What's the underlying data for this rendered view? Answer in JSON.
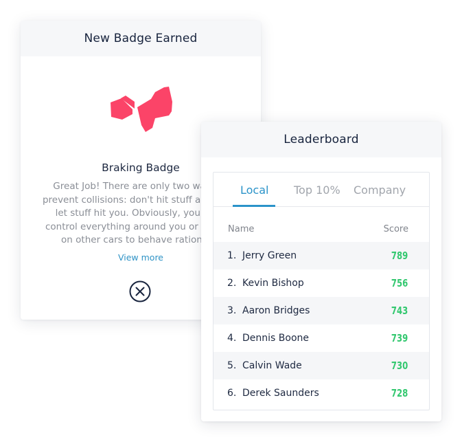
{
  "badge_card": {
    "title": "New Badge Earned",
    "badge_name": "Braking Badge",
    "description": "Great Job! There are only two ways to prevent collisions: don't hit stuff and don't let stuff hit you. Obviously, you can't control everything around you or depend on other cars to behave rationally.",
    "view_more_label": "View more",
    "badge_color": "#fb4468",
    "close_icon": "close-circle-icon"
  },
  "leaderboard": {
    "title": "Leaderboard",
    "tabs": [
      {
        "label": "Local",
        "active": true
      },
      {
        "label": "Top 10%",
        "active": false
      },
      {
        "label": "Company",
        "active": false
      }
    ],
    "columns": {
      "name": "Name",
      "score": "Score"
    },
    "rows": [
      {
        "rank": "1.",
        "name": "Jerry Green",
        "score": "789"
      },
      {
        "rank": "2.",
        "name": "Kevin Bishop",
        "score": "756"
      },
      {
        "rank": "3.",
        "name": "Aaron Bridges",
        "score": "743"
      },
      {
        "rank": "4.",
        "name": "Dennis Boone",
        "score": "739"
      },
      {
        "rank": "5.",
        "name": "Calvin Wade",
        "score": "730"
      },
      {
        "rank": "6.",
        "name": "Derek Saunders",
        "score": "728"
      }
    ],
    "accent_color": "#2a93c9",
    "score_color": "#34c870"
  }
}
